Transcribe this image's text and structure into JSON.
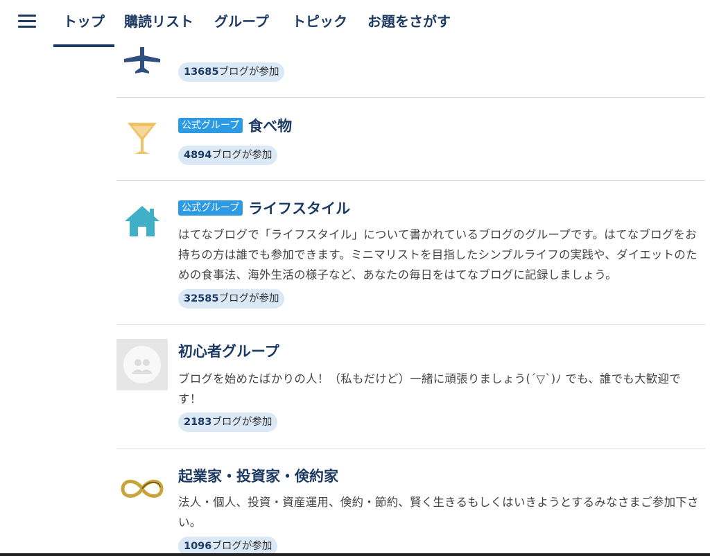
{
  "nav": {
    "tabs": [
      {
        "label": "トップ",
        "active": true
      },
      {
        "label": "購読リスト",
        "active": false
      },
      {
        "label": "グループ",
        "active": false
      },
      {
        "label": "トピック",
        "active": false
      },
      {
        "label": "お題をさがす",
        "active": false
      }
    ]
  },
  "groups": [
    {
      "icon": "airplane-icon",
      "name": "",
      "official": true,
      "description": "",
      "count": "13685",
      "count_suffix": "ブログが参加"
    },
    {
      "icon": "cocktail-glass-icon",
      "name": "食べ物",
      "official": true,
      "official_label": "公式グループ",
      "description": "",
      "count": "4894",
      "count_suffix": "ブログが参加"
    },
    {
      "icon": "house-icon",
      "name": "ライフスタイル",
      "official": true,
      "official_label": "公式グループ",
      "description": "はてなブログで「ライフスタイル」について書かれているブログのグループです。はてなブログをお持ちの方は誰でも参加できます。ミニマリストを目指したシンプルライフの実践や、ダイエットのための食事法、海外生活の様子など、あなたの毎日をはてなブログに記録しましょう。",
      "count": "32585",
      "count_suffix": "ブログが参加"
    },
    {
      "icon": "group-avatar-icon",
      "name": "初心者グループ",
      "official": false,
      "description": "ブログを始めたばかりの人！（私もだけど）一緒に頑張りましょう(´▽`)ﾉ でも、誰でも大歓迎です！",
      "count": "2183",
      "count_suffix": "ブログが参加"
    },
    {
      "icon": "infinity-logo-icon",
      "name": "起業家・投資家・倹約家",
      "official": false,
      "description": "法人・個人、投資・資産運用、倹約・節約、賢く生きるもしくはいきようとするみなさまご参加下さい。",
      "count": "1096",
      "count_suffix": "ブログが参加"
    }
  ],
  "colors": {
    "accent": "#1d3a63",
    "badge": "#2c9be4",
    "count_bg": "#dbe8f5"
  }
}
